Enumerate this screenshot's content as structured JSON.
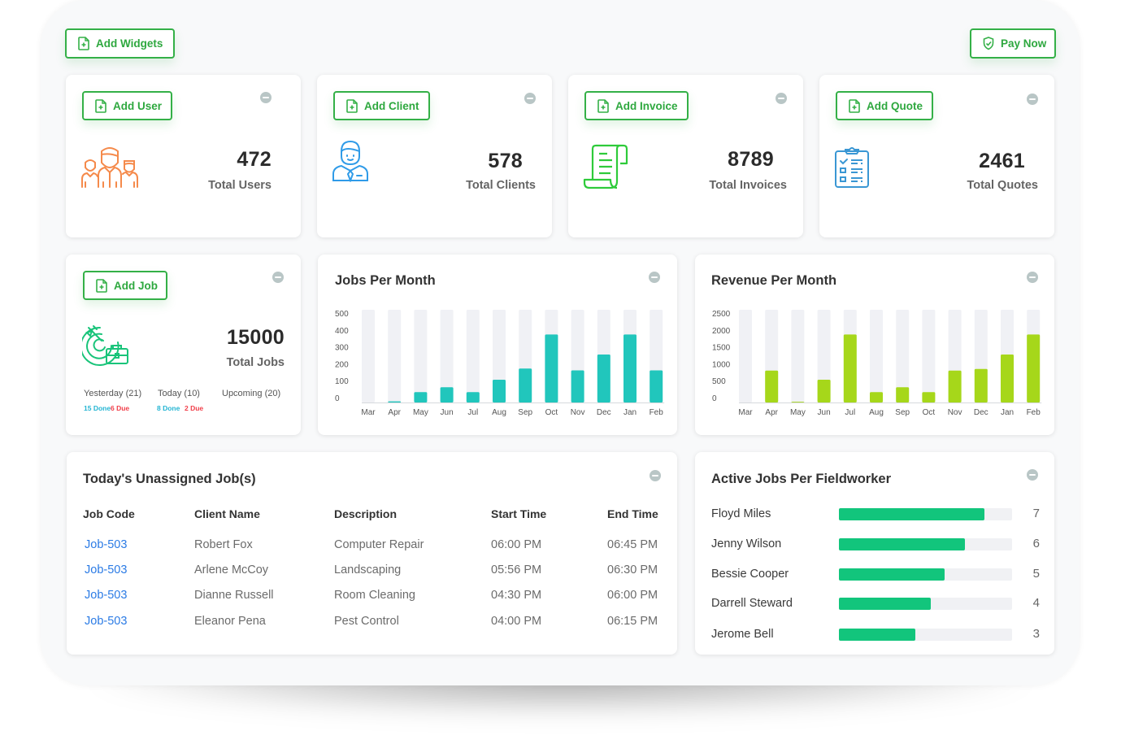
{
  "toolbar": {
    "add_widgets_label": "Add Widgets",
    "pay_now_label": "Pay Now"
  },
  "colors": {
    "accent_green": "#34b047",
    "jobs_bar": "#21c6bc",
    "revenue_bar": "#a6d71a",
    "fieldworker_bar": "#12c57c",
    "link_blue": "#2b7be5",
    "done_blue": "#25b5d3",
    "due_red": "#f1404b"
  },
  "stat_cards": [
    {
      "button_label": "Add User",
      "value": "472",
      "label": "Total Users",
      "icon": "users-group-icon"
    },
    {
      "button_label": "Add Client",
      "value": "578",
      "label": "Total Clients",
      "icon": "client-person-icon"
    },
    {
      "button_label": "Add Invoice",
      "value": "8789",
      "label": "Total Invoices",
      "icon": "invoice-scroll-icon"
    },
    {
      "button_label": "Add Quote",
      "value": "2461",
      "label": "Total Quotes",
      "icon": "clipboard-checklist-icon"
    }
  ],
  "jobs_card": {
    "button_label": "Add Job",
    "value": "15000",
    "label": "Total Jobs",
    "icon": "target-briefcase-icon",
    "yesterday": {
      "label": "Yesterday (21)",
      "done": "15 Done",
      "due": "6 Due"
    },
    "today": {
      "label": "Today (10)",
      "done": "8 Done",
      "due": "2 Due"
    },
    "upcoming": {
      "label": "Upcoming (20)"
    }
  },
  "chart_data": [
    {
      "type": "bar",
      "title": "Jobs Per Month",
      "categories": [
        "Mar",
        "Apr",
        "May",
        "Jun",
        "Jul",
        "Aug",
        "Sep",
        "Oct",
        "Nov",
        "Dec",
        "Jan",
        "Feb"
      ],
      "values": [
        0,
        6,
        56,
        82,
        56,
        123,
        183,
        367,
        173,
        259,
        367,
        173
      ],
      "yticks": [
        "500",
        "400",
        "300",
        "200",
        "100",
        "0"
      ],
      "ylim": [
        0,
        500
      ],
      "xlabel": "",
      "ylabel": "",
      "grid": false,
      "legend": "none"
    },
    {
      "type": "bar",
      "title": "Revenue Per Month",
      "categories": [
        "Mar",
        "Apr",
        "May",
        "Jun",
        "Jul",
        "Aug",
        "Sep",
        "Oct",
        "Nov",
        "Dec",
        "Jan",
        "Feb"
      ],
      "values": [
        0,
        860,
        20,
        615,
        1835,
        280,
        410,
        280,
        860,
        905,
        1295,
        1835
      ],
      "yticks": [
        "2500",
        "2000",
        "1500",
        "1000",
        "500",
        "0"
      ],
      "ylim": [
        0,
        2500
      ],
      "xlabel": "",
      "ylabel": "",
      "grid": false,
      "legend": "none"
    }
  ],
  "unassigned": {
    "title": "Today's Unassigned Job(s)",
    "columns": [
      "Job Code",
      "Client Name",
      "Description",
      "Start Time",
      "End Time"
    ],
    "rows": [
      [
        "Job-503",
        "Robert Fox",
        "Computer Repair",
        "06:00 PM",
        "06:45 PM"
      ],
      [
        "Job-503",
        "Arlene McCoy",
        "Landscaping",
        "05:56 PM",
        "06:30 PM"
      ],
      [
        "Job-503",
        "Dianne Russell",
        "Room Cleaning",
        "04:30 PM",
        "06:00 PM"
      ],
      [
        "Job-503",
        "Eleanor Pena",
        "Pest Control",
        "04:00 PM",
        "06:15 PM"
      ]
    ]
  },
  "fieldworkers": {
    "title": "Active Jobs Per Fieldworker",
    "items": [
      {
        "name": "Floyd Miles",
        "value": "7",
        "fill": 0.84
      },
      {
        "name": "Jenny Wilson",
        "value": "6",
        "fill": 0.73
      },
      {
        "name": "Bessie Cooper",
        "value": "5",
        "fill": 0.61
      },
      {
        "name": "Darrell Steward",
        "value": "4",
        "fill": 0.53
      },
      {
        "name": "Jerome Bell",
        "value": "3",
        "fill": 0.44
      }
    ]
  }
}
